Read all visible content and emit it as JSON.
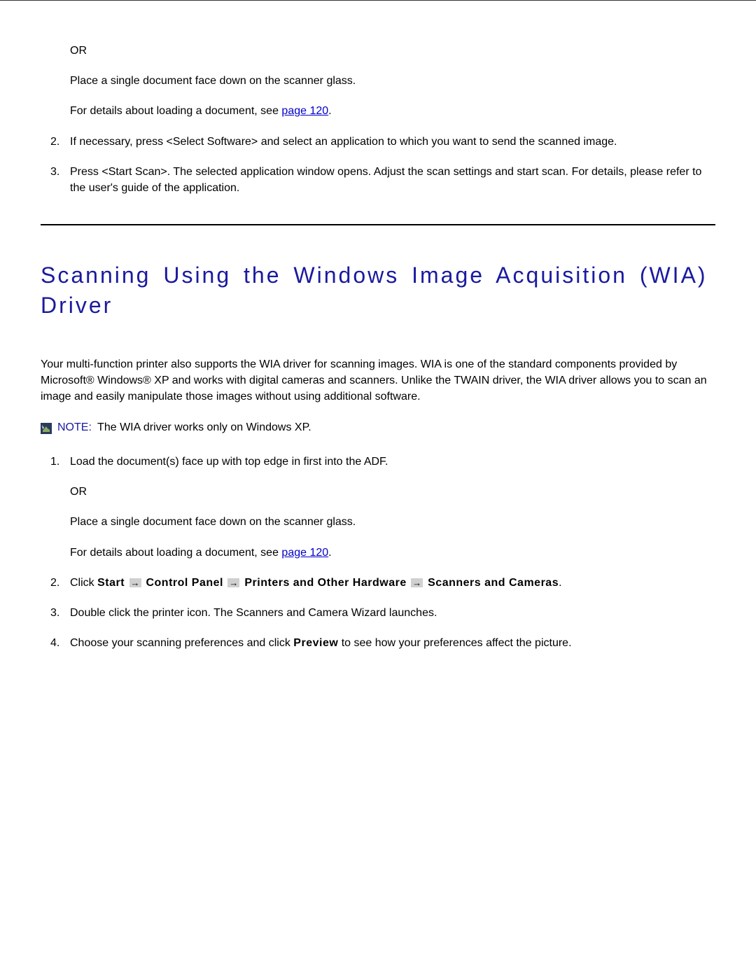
{
  "top": {
    "or": "OR",
    "place": "Place a single document face down on the scanner glass.",
    "details_prefix": "For details about loading a document, see ",
    "details_link": "page 120",
    "details_suffix": ".",
    "item2_num": "2.",
    "item2": "If necessary, press <Select Software> and select an application to which you want to send the scanned image.",
    "item3_num": "3.",
    "item3": "Press <Start Scan>. The selected application window opens. Adjust the scan settings and start scan. For details, please refer to the user's guide of the application."
  },
  "section": {
    "title": "Scanning Using the Windows Image Acquisition (WIA) Driver",
    "intro": "Your multi-function printer also supports the WIA driver for scanning images. WIA is one of the standard components provided by Microsoft® Windows® XP and works with digital cameras and scanners. Unlike the TWAIN driver, the WIA driver allows you to scan an image and easily manipulate those images without using additional software.",
    "note_label": "NOTE:",
    "note_text": " The WIA driver works only on Windows XP.",
    "item1_num": "1.",
    "item1": "Load the document(s) face up with top edge in first into the ADF.",
    "or": "OR",
    "place": "Place a single document face down on the scanner glass.",
    "details_prefix": "For details about loading a document, see ",
    "details_link": "page 120",
    "details_suffix": ".",
    "item2_num": "2.",
    "item2_click": "Click ",
    "item2_start": "Start",
    "item2_cp": " Control Panel",
    "item2_poh": " Printers and Other Hardware",
    "item2_sc": " Scanners and Cameras",
    "item2_end": ".",
    "item3_num": "3.",
    "item3": "Double click the printer icon. The Scanners and Camera Wizard launches.",
    "item4_num": "4.",
    "item4_a": "Choose your scanning preferences and click ",
    "item4_b": "Preview",
    "item4_c": " to see how your preferences affect the picture."
  }
}
